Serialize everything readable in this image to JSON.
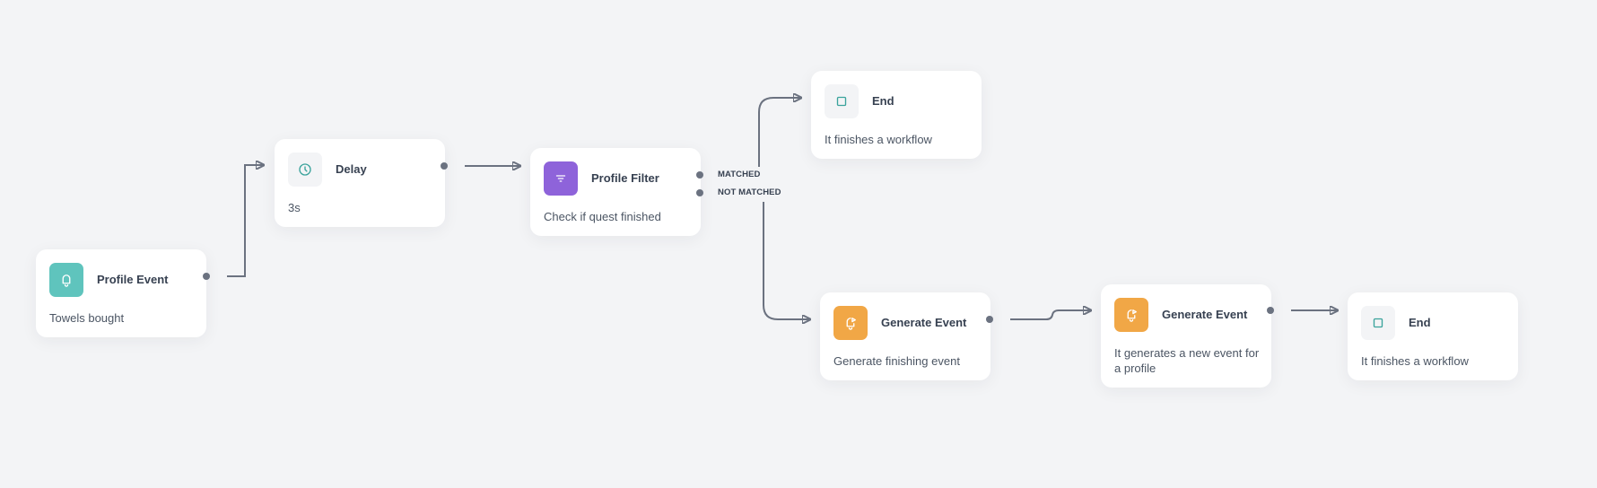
{
  "colors": {
    "background": "#f3f4f6",
    "teal": "#5fc4bd",
    "purple": "#8e63da",
    "orange": "#f1a746",
    "neutral_icon_bg": "#f3f4f6",
    "edge": "#6b7280"
  },
  "nodes": [
    {
      "id": "profile-event",
      "title": "Profile Event",
      "description": "Towels bought",
      "icon": "bell-icon",
      "icon_color": "#5fc4bd"
    },
    {
      "id": "delay",
      "title": "Delay",
      "description": "3s",
      "icon": "clock-icon",
      "icon_color": "#f3f4f6"
    },
    {
      "id": "profile-filter",
      "title": "Profile Filter",
      "description": "Check if quest finished",
      "icon": "filter-icon",
      "icon_color": "#8e63da"
    },
    {
      "id": "end-matched",
      "title": "End",
      "description": "It finishes a workflow",
      "icon": "stop-square-icon",
      "icon_color": "#f3f4f6"
    },
    {
      "id": "generate-event-1",
      "title": "Generate Event",
      "description": "Generate finishing event",
      "icon": "bell-play-icon",
      "icon_color": "#f1a746"
    },
    {
      "id": "generate-event-2",
      "title": "Generate Event",
      "description": "It generates a new event for a profile",
      "icon": "bell-play-icon",
      "icon_color": "#f1a746"
    },
    {
      "id": "end-final",
      "title": "End",
      "description": "It finishes a workflow",
      "icon": "stop-square-icon",
      "icon_color": "#f3f4f6"
    }
  ],
  "ports": {
    "matched_label": "MATCHED",
    "not_matched_label": "NOT MATCHED"
  },
  "edges": [
    {
      "from": "profile-event",
      "to": "delay"
    },
    {
      "from": "delay",
      "to": "profile-filter"
    },
    {
      "from": "profile-filter",
      "port": "MATCHED",
      "to": "end-matched"
    },
    {
      "from": "profile-filter",
      "port": "NOT MATCHED",
      "to": "generate-event-1"
    },
    {
      "from": "generate-event-1",
      "to": "generate-event-2"
    },
    {
      "from": "generate-event-2",
      "to": "end-final"
    }
  ]
}
